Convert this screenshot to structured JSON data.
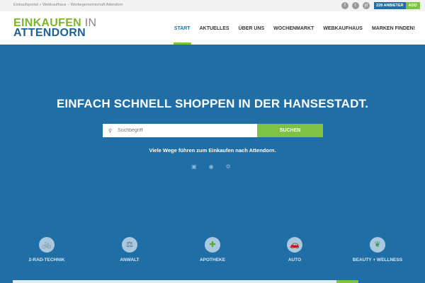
{
  "topbar": {
    "breadcrumb": "Einkaufsportal » Webkaufhaus – Werbegemeinschaft Attendorn",
    "social": [
      "f",
      "t",
      "yt"
    ],
    "count_label": "228 ANBIETER",
    "add_label": "ADD"
  },
  "logo": {
    "line1a": "EINKAUFEN",
    "line1b": "IN",
    "line2": "ATTENDORN"
  },
  "nav": [
    "START",
    "AKTUELLES",
    "ÜBER UNS",
    "WOCHENMARKT",
    "WEBKAUFHAUS",
    "MARKEN FINDEN!"
  ],
  "hero": {
    "headline": "EINFACH SCHNELL SHOPPEN IN DER HANSESTADT.",
    "search_placeholder": "Suchbegriff",
    "search_button": "SUCHEN",
    "tagline": "Viele Wege führen zum Einkaufen nach Attendorn."
  },
  "categories": [
    {
      "label": "2-RAD-TECHNIK",
      "icon": "🚲"
    },
    {
      "label": "ANWALT",
      "icon": "⚖"
    },
    {
      "label": "APOTHEKE",
      "icon": "✚"
    },
    {
      "label": "AUTO",
      "icon": "🚗"
    },
    {
      "label": "BEAUTY + WELLNESS",
      "icon": "❦"
    }
  ]
}
